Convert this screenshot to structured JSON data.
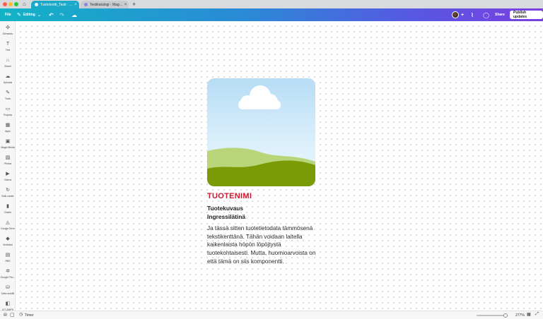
{
  "browser": {
    "tabs": [
      {
        "label": "Tuotekortti_Testi - ..."
      },
      {
        "label": "Testikatalogi - Mag..."
      }
    ],
    "new_tab_label": "+"
  },
  "toolbar": {
    "file_label": "File",
    "mode_label": "Editing",
    "share_label": "Share",
    "publish_label": "Publish updates"
  },
  "sidebar": {
    "items": [
      {
        "label": "Elements",
        "icon": "elements-icon",
        "glyph": "✣"
      },
      {
        "label": "Text",
        "icon": "text-icon",
        "glyph": "T"
      },
      {
        "label": "Brand",
        "icon": "brand-icon",
        "glyph": "⌂"
      },
      {
        "label": "Uploads",
        "icon": "uploads-icon",
        "glyph": "☁"
      },
      {
        "label": "Tools",
        "icon": "tools-icon",
        "glyph": "✎"
      },
      {
        "label": "Projects",
        "icon": "projects-icon",
        "glyph": "▭"
      },
      {
        "label": "Apps",
        "icon": "apps-icon",
        "glyph": "▦"
      },
      {
        "label": "Magic Media",
        "icon": "magic-media-icon",
        "glyph": "▣"
      },
      {
        "label": "Photos",
        "icon": "photos-icon",
        "glyph": "▧"
      },
      {
        "label": "Videos",
        "icon": "videos-icon",
        "glyph": "▶"
      },
      {
        "label": "Bulk create",
        "icon": "bulk-create-icon",
        "glyph": "↻"
      },
      {
        "label": "Charts",
        "icon": "charts-icon",
        "glyph": "▮"
      },
      {
        "label": "Google Drive",
        "icon": "google-drive-icon",
        "glyph": "◬"
      },
      {
        "label": "Verifiointi",
        "icon": "verifiointi-icon",
        "glyph": "◆"
      },
      {
        "label": "RBS",
        "icon": "rbs-icon",
        "glyph": "▤"
      },
      {
        "label": "Google Pho...",
        "icon": "google-photos-icon",
        "glyph": "✲"
      },
      {
        "label": "Data autofill",
        "icon": "data-autofill-icon",
        "glyph": "⛁"
      },
      {
        "label": "ICT-AMPS",
        "icon": "ict-amps-icon",
        "glyph": "◧"
      }
    ]
  },
  "card": {
    "name": "TUOTENIMI",
    "description": "Tuotekuvaus",
    "ingress": "Ingressilätinä",
    "body": "Ja tässä sitten tuotetietodata tämmösenä tekstikenttänä. Tähän voidaan laitella kaikenlaista höpön löpöjtystä tuotekohtaisesti. Mutta, huomioarvoista on että tämä on siis komponentti."
  },
  "bottom": {
    "timer_label": "Timer",
    "zoom": "277%"
  },
  "colors": {
    "product_name": "#d3142f",
    "hill_front": "#7a9b06",
    "hill_back": "#b8d679"
  }
}
